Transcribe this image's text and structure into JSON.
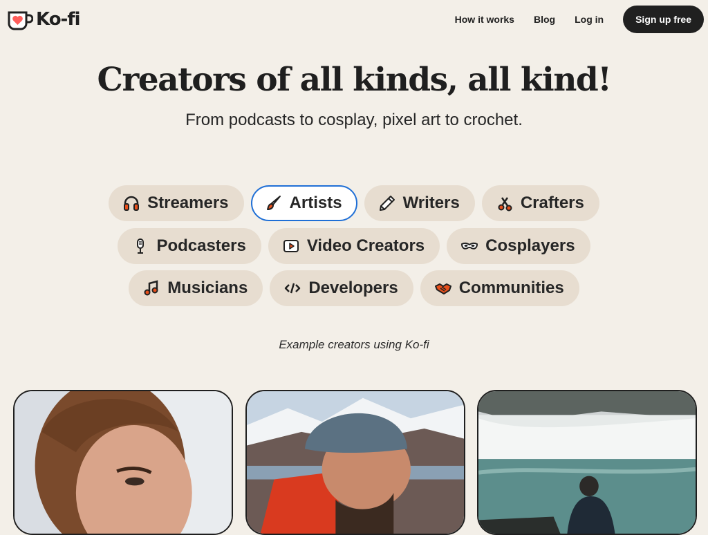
{
  "header": {
    "logo_text": "Ko-fi",
    "logo_icon": "kofi-cup-heart-icon",
    "nav": [
      {
        "label": "How it works"
      },
      {
        "label": "Blog"
      },
      {
        "label": "Log in"
      }
    ],
    "signup_label": "Sign up free"
  },
  "hero": {
    "title": "Creators of all kinds, all kind!",
    "subtitle": "From podcasts to cosplay, pixel art to crochet."
  },
  "categories": [
    {
      "label": "Streamers",
      "icon": "headphones-icon",
      "active": false
    },
    {
      "label": "Artists",
      "icon": "paintbrush-icon",
      "active": true
    },
    {
      "label": "Writers",
      "icon": "pencil-icon",
      "active": false
    },
    {
      "label": "Crafters",
      "icon": "scissors-icon",
      "active": false
    },
    {
      "label": "Podcasters",
      "icon": "microphone-icon",
      "active": false
    },
    {
      "label": "Video Creators",
      "icon": "video-play-icon",
      "active": false
    },
    {
      "label": "Cosplayers",
      "icon": "mask-icon",
      "active": false
    },
    {
      "label": "Musicians",
      "icon": "music-note-icon",
      "active": false
    },
    {
      "label": "Developers",
      "icon": "code-icon",
      "active": false
    },
    {
      "label": "Communities",
      "icon": "handshake-icon",
      "active": false
    }
  ],
  "examples": {
    "caption": "Example creators using Ko-fi"
  },
  "colors": {
    "background": "#f3efe8",
    "chip": "#e7ddd0",
    "active_border": "#1f6fd6",
    "brand_red": "#ff5e5b",
    "icon_orange": "#e8501c"
  }
}
